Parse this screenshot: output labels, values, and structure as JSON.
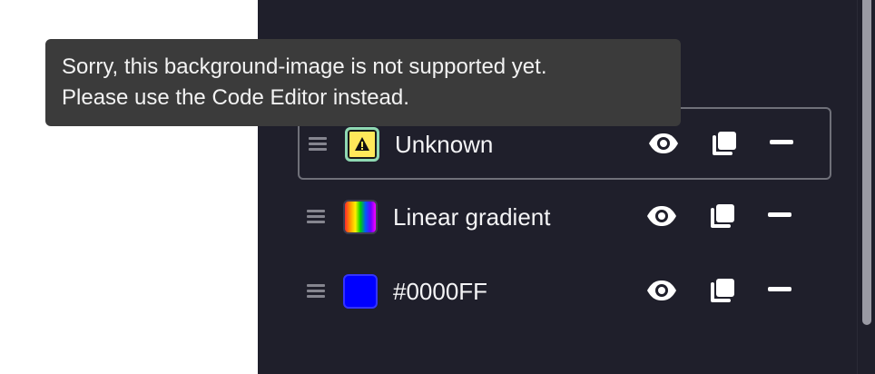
{
  "tooltip": {
    "line1": "Sorry, this background-image is not supported yet.",
    "line2": "Please use the Code Editor instead."
  },
  "layers": [
    {
      "label": "Unknown",
      "swatch": "warning-swatch",
      "selected": true
    },
    {
      "label": "Linear gradient",
      "swatch": "rainbow-gradient-swatch",
      "selected": false
    },
    {
      "label": "#0000FF",
      "swatch": "solid-color-swatch",
      "color": "#0000FF",
      "selected": false
    }
  ],
  "icons": {
    "drag": "drag-handle-icon",
    "visibility": "eye-icon",
    "duplicate": "duplicate-icon",
    "remove": "minus-icon",
    "warning": "warning-icon"
  },
  "colors": {
    "panel_bg": "#1f1f2b",
    "tooltip_bg": "#3b3b3b",
    "text": "#f4f4f6",
    "selected_border": "#6f7079"
  }
}
